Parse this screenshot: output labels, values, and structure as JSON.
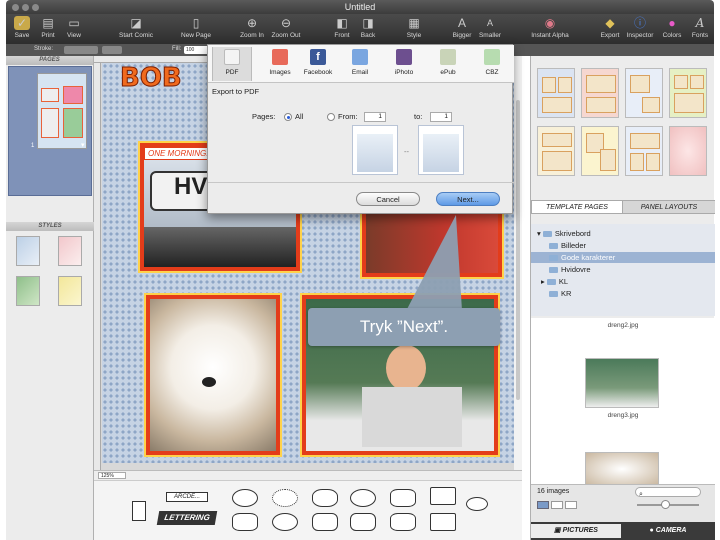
{
  "window": {
    "title": "Untitled"
  },
  "toolbar": {
    "items": [
      {
        "label": "Save",
        "icon": "save-icon"
      },
      {
        "label": "Print",
        "icon": "print-icon"
      },
      {
        "label": "View",
        "icon": "view-icon"
      },
      {
        "label": "Start Comic",
        "icon": "start-comic-icon"
      },
      {
        "label": "New Page",
        "icon": "new-page-icon"
      },
      {
        "label": "Zoom In",
        "icon": "zoom-in-icon"
      },
      {
        "label": "Zoom Out",
        "icon": "zoom-out-icon"
      },
      {
        "label": "Front",
        "icon": "front-icon"
      },
      {
        "label": "Back",
        "icon": "back-icon"
      },
      {
        "label": "Style",
        "icon": "style-icon"
      },
      {
        "label": "Bigger",
        "icon": "bigger-icon"
      },
      {
        "label": "Smaller",
        "icon": "smaller-icon"
      },
      {
        "label": "Instant Alpha",
        "icon": "instant-alpha-icon"
      },
      {
        "label": "Export",
        "icon": "export-icon"
      },
      {
        "label": "Inspector",
        "icon": "inspector-icon"
      },
      {
        "label": "Colors",
        "icon": "colors-icon"
      },
      {
        "label": "Fonts",
        "icon": "fonts-icon"
      }
    ]
  },
  "subbar": {
    "stroke_label": "Stroke:",
    "fill_label": "Fill:",
    "size_value": "100"
  },
  "left": {
    "pages_header": "PAGES",
    "page_number": "1",
    "styles_header": "STYLES"
  },
  "canvas": {
    "zoom": "125%",
    "panel_caption": "ONE MORNING...",
    "sign_text": "HVIL",
    "title_art": "BOB"
  },
  "export": {
    "tabs": [
      {
        "label": "PDF",
        "icon": "pdf-icon"
      },
      {
        "label": "Images",
        "icon": "images-icon"
      },
      {
        "label": "Facebook",
        "icon": "facebook-icon"
      },
      {
        "label": "Email",
        "icon": "email-icon"
      },
      {
        "label": "iPhoto",
        "icon": "iphoto-icon"
      },
      {
        "label": "ePub",
        "icon": "epub-icon"
      },
      {
        "label": "CBZ",
        "icon": "cbz-icon"
      }
    ],
    "heading": "Export to PDF",
    "pages_label": "Pages:",
    "all_label": "All",
    "from_label": "From:",
    "from_value": "1",
    "to_label": "to:",
    "to_value": "1",
    "range_dash": "--",
    "cancel": "Cancel",
    "next": "Next..."
  },
  "callout": {
    "text": "Tryk ”Next”."
  },
  "right": {
    "tabs": {
      "template_pages": "TEMPLATE PAGES",
      "panel_layouts": "PANEL LAYOUTS"
    },
    "tree": [
      {
        "label": "Skrivebord",
        "expanded": true,
        "indent": 0
      },
      {
        "label": "Billeder",
        "indent": 1
      },
      {
        "label": "Gode karakterer",
        "indent": 1,
        "selected": true
      },
      {
        "label": "Hvidovre",
        "indent": 1
      },
      {
        "label": "KL",
        "indent": 1
      },
      {
        "label": "KR",
        "indent": 1
      }
    ],
    "pictures": [
      {
        "caption": "dreng2.jpg"
      },
      {
        "caption": "dreng3.jpg"
      }
    ],
    "image_count": "16 images",
    "bottom_tabs": {
      "pictures": "PICTURES",
      "camera": "CAMERA"
    }
  },
  "tray": {
    "arcade_label": "ARCDE...",
    "lettering_label": "LETTERING"
  },
  "colors": {
    "accent": "#5e9ae6",
    "panel_border": "#e33c1a",
    "callout": "#8d9fb2"
  }
}
